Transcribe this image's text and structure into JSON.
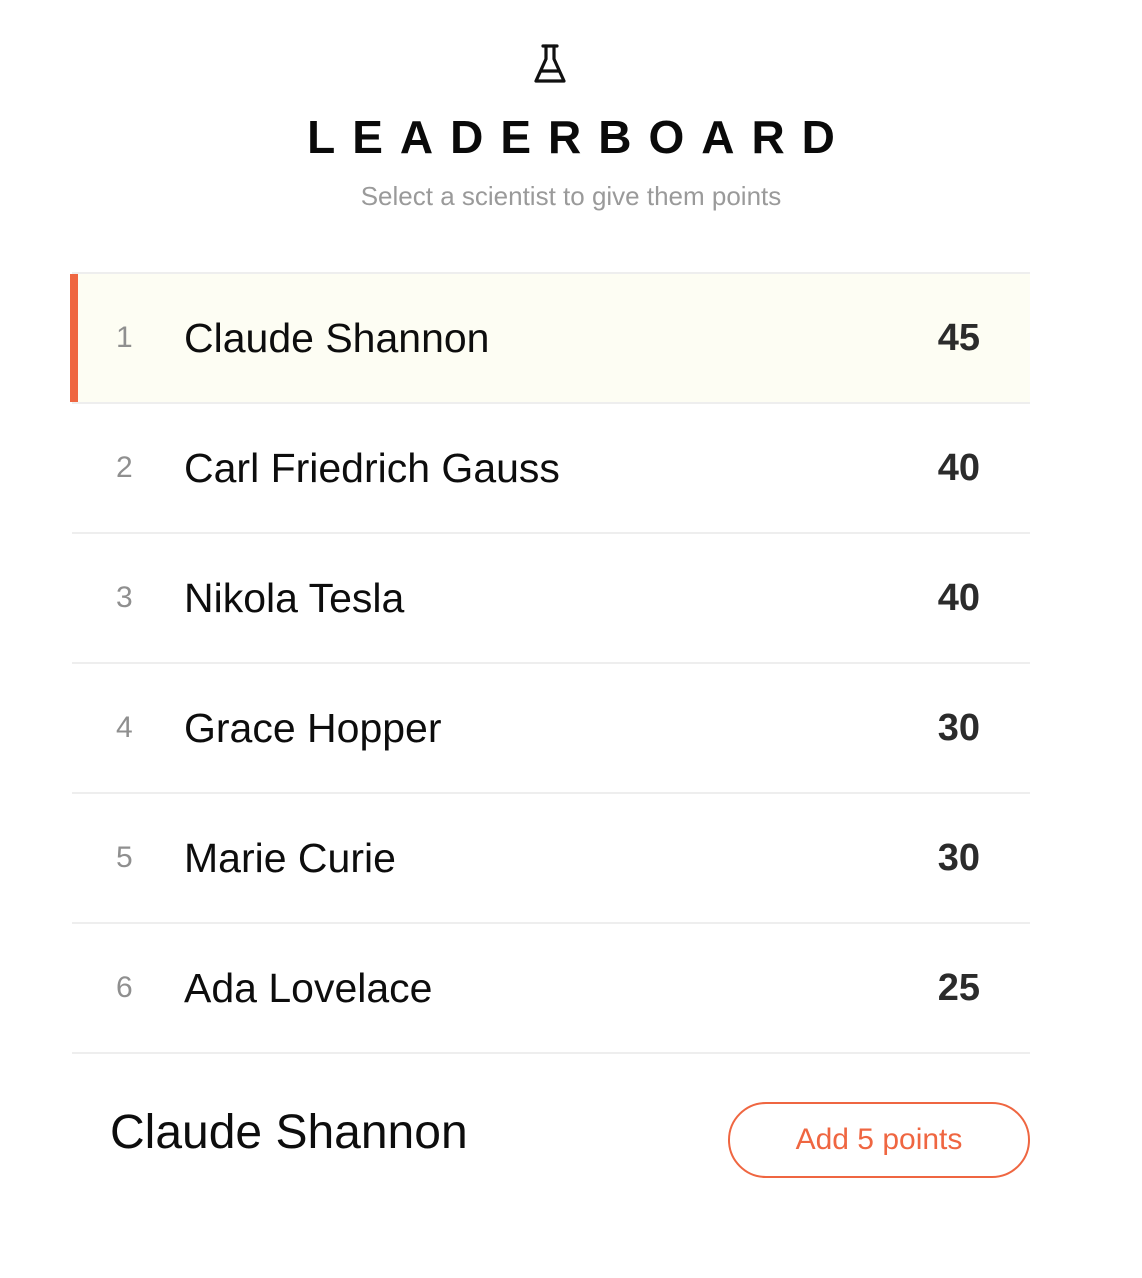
{
  "header": {
    "logo_icon": "flask-icon",
    "title": "LEADERBOARD",
    "subtitle": "Select a scientist to give them points"
  },
  "leaderboard": {
    "selected_rank": 1,
    "accent_color": "#ef6641",
    "rows": [
      {
        "rank": "1",
        "name": "Claude Shannon",
        "score": "45"
      },
      {
        "rank": "2",
        "name": "Carl Friedrich Gauss",
        "score": "40"
      },
      {
        "rank": "3",
        "name": "Nikola Tesla",
        "score": "40"
      },
      {
        "rank": "4",
        "name": "Grace Hopper",
        "score": "30"
      },
      {
        "rank": "5",
        "name": "Marie Curie",
        "score": "30"
      },
      {
        "rank": "6",
        "name": "Ada Lovelace",
        "score": "25"
      }
    ]
  },
  "footer": {
    "selected_name": "Claude Shannon",
    "add_button_label": "Add 5 points"
  }
}
